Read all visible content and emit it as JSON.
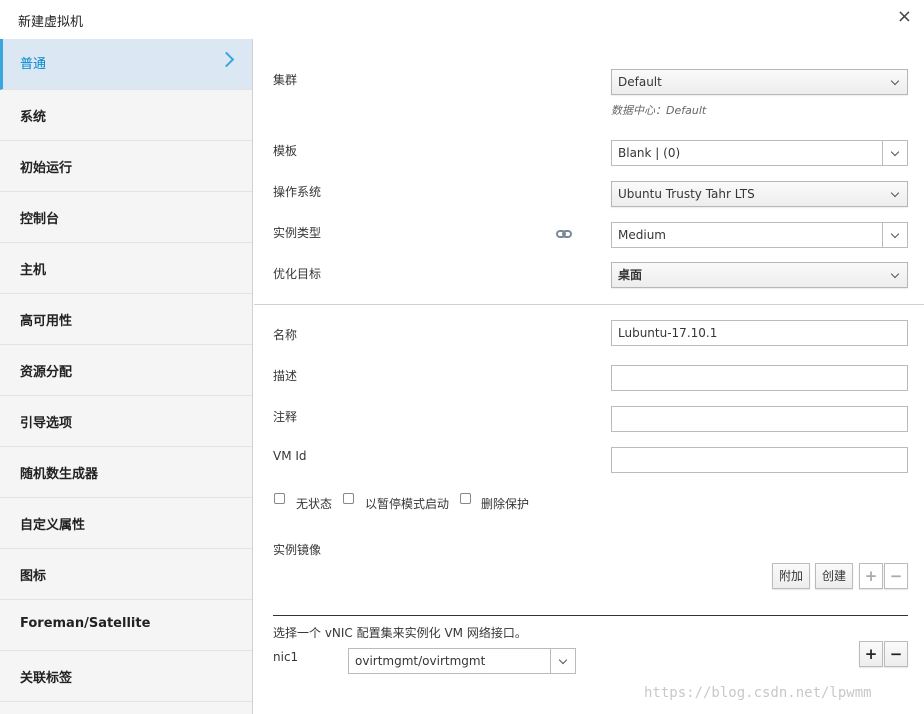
{
  "dialog": {
    "title": "新建虚拟机",
    "close_glyph": "×"
  },
  "sidebar": {
    "items": [
      {
        "label": "普通"
      },
      {
        "label": "系统"
      },
      {
        "label": "初始运行"
      },
      {
        "label": "控制台"
      },
      {
        "label": "主机"
      },
      {
        "label": "高可用性"
      },
      {
        "label": "资源分配"
      },
      {
        "label": "引导选项"
      },
      {
        "label": "随机数生成器"
      },
      {
        "label": "自定义属性"
      },
      {
        "label": "图标"
      },
      {
        "label": "Foreman/Satellite"
      },
      {
        "label": "关联标签"
      }
    ],
    "active_index": 0
  },
  "form": {
    "cluster": {
      "label": "集群",
      "value": "Default",
      "hint": "数据中心：Default"
    },
    "template": {
      "label": "模板",
      "value": "Blank |  (0)"
    },
    "os": {
      "label": "操作系统",
      "value": "Ubuntu Trusty Tahr LTS"
    },
    "instance_type": {
      "label": "实例类型",
      "value": "Medium",
      "icon": "link-icon"
    },
    "optimize": {
      "label": "优化目标",
      "value": "桌面"
    },
    "name": {
      "label": "名称",
      "value": "Lubuntu-17.10.1"
    },
    "description": {
      "label": "描述",
      "value": ""
    },
    "comment": {
      "label": "注释",
      "value": ""
    },
    "vm_id": {
      "label": "VM Id",
      "value": ""
    },
    "checkboxes": [
      {
        "label": "无状态",
        "checked": false
      },
      {
        "label": "以暂停模式启动",
        "checked": false
      },
      {
        "label": "删除保护",
        "checked": false
      }
    ],
    "instance_images": {
      "label": "实例镜像",
      "attach_label": "附加",
      "create_label": "创建",
      "plus": "+",
      "minus": "−"
    },
    "vnic": {
      "instruction": "选择一个 vNIC 配置集来实例化 VM 网络接口。",
      "nic_label": "nic1",
      "nic_value": "ovirtmgmt/ovirtmgmt",
      "plus": "+",
      "minus": "−"
    }
  },
  "watermark": "https://blog.csdn.net/lpwmm"
}
